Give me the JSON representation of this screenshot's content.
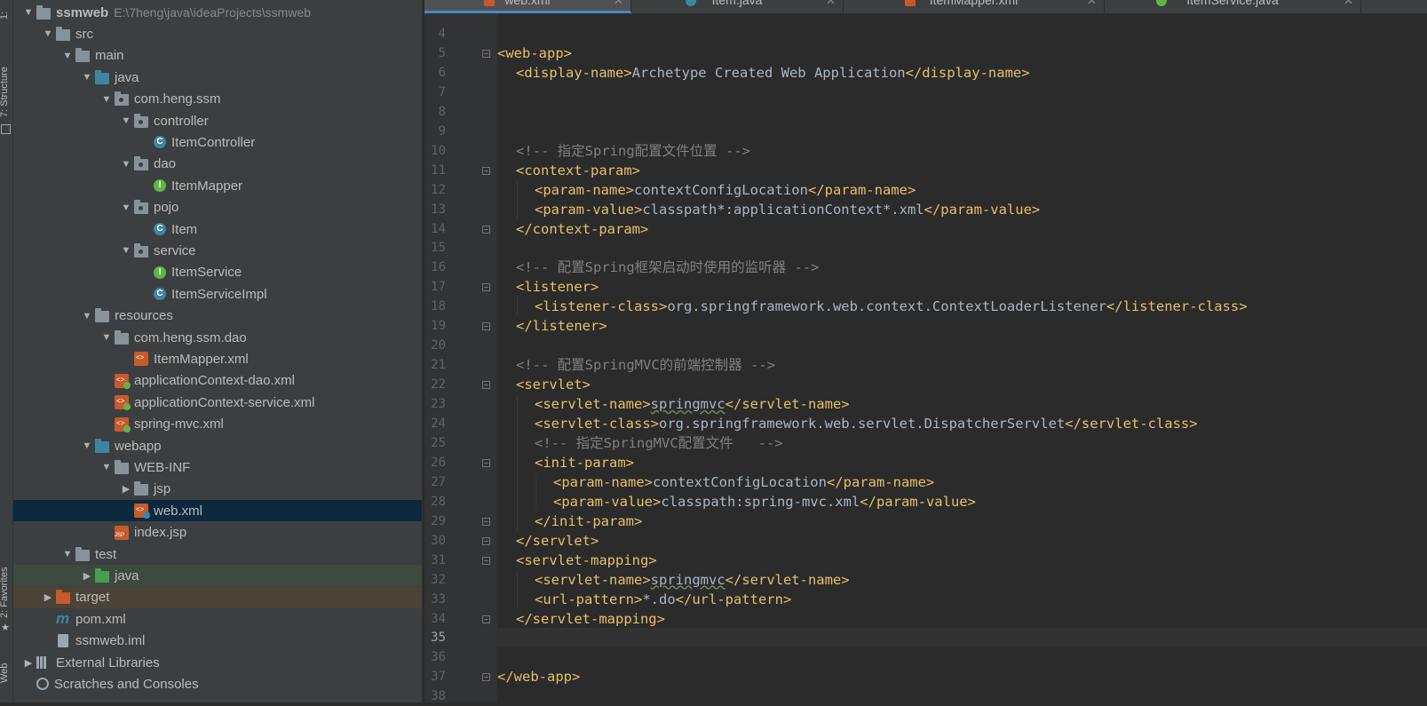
{
  "toolstrip": {
    "structure_label": "7: Structure",
    "favorites_label": "2: Favorites",
    "web_label": "Web",
    "top_label": "1:"
  },
  "project": {
    "rows": [
      {
        "depth": 0,
        "arrow": "down",
        "icon": "folder",
        "label": "ssmweb",
        "bold": true,
        "path": "E:\\7heng\\java\\ideaProjects\\ssmweb"
      },
      {
        "depth": 1,
        "arrow": "down",
        "icon": "folder",
        "label": "src"
      },
      {
        "depth": 2,
        "arrow": "down",
        "icon": "folder",
        "label": "main"
      },
      {
        "depth": 3,
        "arrow": "down",
        "icon": "folder-blue",
        "label": "java"
      },
      {
        "depth": 4,
        "arrow": "down",
        "icon": "package",
        "label": "com.heng.ssm"
      },
      {
        "depth": 5,
        "arrow": "down",
        "icon": "package",
        "label": "controller"
      },
      {
        "depth": 6,
        "arrow": "none",
        "icon": "class",
        "label": "ItemController"
      },
      {
        "depth": 5,
        "arrow": "down",
        "icon": "package",
        "label": "dao"
      },
      {
        "depth": 6,
        "arrow": "none",
        "icon": "interface",
        "label": "ItemMapper"
      },
      {
        "depth": 5,
        "arrow": "down",
        "icon": "package",
        "label": "pojo"
      },
      {
        "depth": 6,
        "arrow": "none",
        "icon": "class",
        "label": "Item"
      },
      {
        "depth": 5,
        "arrow": "down",
        "icon": "package",
        "label": "service"
      },
      {
        "depth": 6,
        "arrow": "none",
        "icon": "interface",
        "label": "ItemService"
      },
      {
        "depth": 6,
        "arrow": "none",
        "icon": "class",
        "label": "ItemServiceImpl"
      },
      {
        "depth": 3,
        "arrow": "down",
        "icon": "folder-res",
        "label": "resources"
      },
      {
        "depth": 4,
        "arrow": "down",
        "icon": "folder",
        "label": "com.heng.ssm.dao"
      },
      {
        "depth": 5,
        "arrow": "none",
        "icon": "xml",
        "label": "ItemMapper.xml"
      },
      {
        "depth": 4,
        "arrow": "none",
        "icon": "xml-spring",
        "label": "applicationContext-dao.xml"
      },
      {
        "depth": 4,
        "arrow": "none",
        "icon": "xml-spring",
        "label": "applicationContext-service.xml"
      },
      {
        "depth": 4,
        "arrow": "none",
        "icon": "xml-spring",
        "label": "spring-mvc.xml"
      },
      {
        "depth": 3,
        "arrow": "down",
        "icon": "folder-web",
        "label": "webapp"
      },
      {
        "depth": 4,
        "arrow": "down",
        "icon": "folder",
        "label": "WEB-INF"
      },
      {
        "depth": 5,
        "arrow": "right",
        "icon": "folder",
        "label": "jsp"
      },
      {
        "depth": 5,
        "arrow": "none",
        "icon": "xml-web",
        "label": "web.xml",
        "state": "selected"
      },
      {
        "depth": 4,
        "arrow": "none",
        "icon": "jsp",
        "label": "index.jsp"
      },
      {
        "depth": 2,
        "arrow": "down",
        "icon": "folder",
        "label": "test"
      },
      {
        "depth": 3,
        "arrow": "right",
        "icon": "folder-green",
        "label": "java",
        "state": "hl-green"
      },
      {
        "depth": 1,
        "arrow": "right",
        "icon": "folder-orange",
        "label": "target",
        "state": "hl-tan"
      },
      {
        "depth": 1,
        "arrow": "none",
        "icon": "maven",
        "label": "pom.xml"
      },
      {
        "depth": 1,
        "arrow": "none",
        "icon": "iml",
        "label": "ssmweb.iml"
      },
      {
        "depth": 0,
        "arrow": "right",
        "icon": "libraries",
        "label": "External Libraries"
      },
      {
        "depth": 0,
        "arrow": "none",
        "icon": "scratches",
        "label": "Scratches and Consoles"
      }
    ]
  },
  "tabs": [
    {
      "label": "web.xml",
      "icon": "xml",
      "active": true
    },
    {
      "label": "Item.java",
      "icon": "class",
      "active": false
    },
    {
      "label": "ItemMapper.xml",
      "icon": "xml",
      "active": false
    },
    {
      "label": "ItemService.java",
      "icon": "interface",
      "active": false
    }
  ],
  "editor": {
    "current_line": "35",
    "lines": [
      {
        "n": "4",
        "indent": 0,
        "parts": []
      },
      {
        "n": "5",
        "indent": 0,
        "fold": true,
        "parts": [
          {
            "t": "tag",
            "v": "<web-app>"
          }
        ]
      },
      {
        "n": "6",
        "indent": 1,
        "parts": [
          {
            "t": "tag",
            "v": "<display-name>"
          },
          {
            "t": "text",
            "v": "Archetype Created Web Application"
          },
          {
            "t": "tag",
            "v": "</display-name>"
          }
        ]
      },
      {
        "n": "7",
        "indent": 0,
        "parts": []
      },
      {
        "n": "8",
        "indent": 0,
        "parts": []
      },
      {
        "n": "9",
        "indent": 0,
        "parts": []
      },
      {
        "n": "10",
        "indent": 1,
        "parts": [
          {
            "t": "comment",
            "v": "<!-- 指定Spring配置文件位置 -->"
          }
        ]
      },
      {
        "n": "11",
        "indent": 1,
        "fold": true,
        "parts": [
          {
            "t": "tag",
            "v": "<context-param>"
          }
        ]
      },
      {
        "n": "12",
        "indent": 2,
        "parts": [
          {
            "t": "tag",
            "v": "<param-name>"
          },
          {
            "t": "text",
            "v": "contextConfigLocation"
          },
          {
            "t": "tag",
            "v": "</param-name>"
          }
        ]
      },
      {
        "n": "13",
        "indent": 2,
        "parts": [
          {
            "t": "tag",
            "v": "<param-value>"
          },
          {
            "t": "text",
            "v": "classpath*:applicationContext*.xml"
          },
          {
            "t": "tag",
            "v": "</param-value>"
          }
        ]
      },
      {
        "n": "14",
        "indent": 1,
        "fold": true,
        "parts": [
          {
            "t": "tag",
            "v": "</context-param>"
          }
        ]
      },
      {
        "n": "15",
        "indent": 0,
        "parts": []
      },
      {
        "n": "16",
        "indent": 1,
        "parts": [
          {
            "t": "comment",
            "v": "<!-- 配置Spring框架启动时使用的监听器 -->"
          }
        ]
      },
      {
        "n": "17",
        "indent": 1,
        "fold": true,
        "parts": [
          {
            "t": "tag",
            "v": "<listener>"
          }
        ]
      },
      {
        "n": "18",
        "indent": 2,
        "parts": [
          {
            "t": "tag",
            "v": "<listener-class>"
          },
          {
            "t": "text",
            "v": "org.springframework.web.context.ContextLoaderListener"
          },
          {
            "t": "tag",
            "v": "</listener-class>"
          }
        ]
      },
      {
        "n": "19",
        "indent": 1,
        "fold": true,
        "parts": [
          {
            "t": "tag",
            "v": "</listener>"
          }
        ]
      },
      {
        "n": "20",
        "indent": 0,
        "parts": []
      },
      {
        "n": "21",
        "indent": 1,
        "parts": [
          {
            "t": "comment",
            "v": "<!-- 配置SpringMVC的前端控制器 -->"
          }
        ]
      },
      {
        "n": "22",
        "indent": 1,
        "fold": true,
        "parts": [
          {
            "t": "tag",
            "v": "<servlet>"
          }
        ]
      },
      {
        "n": "23",
        "indent": 2,
        "parts": [
          {
            "t": "tag",
            "v": "<servlet-name>"
          },
          {
            "t": "squig",
            "v": "springmvc"
          },
          {
            "t": "tag",
            "v": "</servlet-name>"
          }
        ]
      },
      {
        "n": "24",
        "indent": 2,
        "parts": [
          {
            "t": "tag",
            "v": "<servlet-class>"
          },
          {
            "t": "text",
            "v": "org.springframework.web.servlet.DispatcherServlet"
          },
          {
            "t": "tag",
            "v": "</servlet-class>"
          }
        ]
      },
      {
        "n": "25",
        "indent": 2,
        "parts": [
          {
            "t": "comment",
            "v": "<!-- 指定SpringMVC配置文件   -->"
          }
        ]
      },
      {
        "n": "26",
        "indent": 2,
        "fold": true,
        "parts": [
          {
            "t": "tag",
            "v": "<init-param>"
          }
        ]
      },
      {
        "n": "27",
        "indent": 3,
        "parts": [
          {
            "t": "tag",
            "v": "<param-name>"
          },
          {
            "t": "text",
            "v": "contextConfigLocation"
          },
          {
            "t": "tag",
            "v": "</param-name>"
          }
        ]
      },
      {
        "n": "28",
        "indent": 3,
        "parts": [
          {
            "t": "tag",
            "v": "<param-value>"
          },
          {
            "t": "text",
            "v": "classpath:spring-mvc.xml"
          },
          {
            "t": "tag",
            "v": "</param-value>"
          }
        ]
      },
      {
        "n": "29",
        "indent": 2,
        "fold": true,
        "parts": [
          {
            "t": "tag",
            "v": "</init-param>"
          }
        ]
      },
      {
        "n": "30",
        "indent": 1,
        "fold": true,
        "parts": [
          {
            "t": "tag",
            "v": "</servlet>"
          }
        ]
      },
      {
        "n": "31",
        "indent": 1,
        "fold": true,
        "parts": [
          {
            "t": "tag",
            "v": "<servlet-mapping>"
          }
        ]
      },
      {
        "n": "32",
        "indent": 2,
        "parts": [
          {
            "t": "tag",
            "v": "<servlet-name>"
          },
          {
            "t": "squig",
            "v": "springmvc"
          },
          {
            "t": "tag",
            "v": "</servlet-name>"
          }
        ]
      },
      {
        "n": "33",
        "indent": 2,
        "parts": [
          {
            "t": "tag",
            "v": "<url-pattern>"
          },
          {
            "t": "text",
            "v": "*.do"
          },
          {
            "t": "tag",
            "v": "</url-pattern>"
          }
        ]
      },
      {
        "n": "34",
        "indent": 1,
        "fold": true,
        "parts": [
          {
            "t": "tag",
            "v": "</servlet-mapping>"
          }
        ]
      },
      {
        "n": "35",
        "indent": 0,
        "parts": []
      },
      {
        "n": "36",
        "indent": 0,
        "parts": []
      },
      {
        "n": "37",
        "indent": 0,
        "fold": true,
        "parts": [
          {
            "t": "tag",
            "v": "</web-app>"
          }
        ]
      },
      {
        "n": "38",
        "indent": 0,
        "parts": []
      }
    ]
  },
  "colors": {
    "tag": "#e8bf6a",
    "text": "#a9b7c6",
    "comment": "#808080",
    "selection": "#0d293e",
    "panel": "#3c3f41",
    "editor_bg": "#2b2b2b"
  }
}
